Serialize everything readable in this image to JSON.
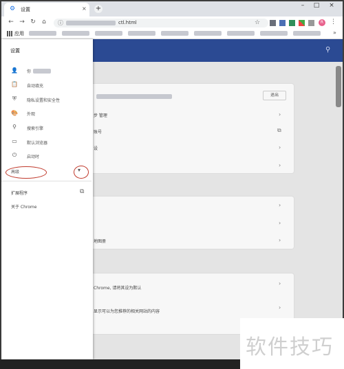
{
  "tab": {
    "title": "设置",
    "close": "×"
  },
  "newtab": "+",
  "window": {
    "minimize": "–",
    "maximize": "□",
    "close": "×"
  },
  "toolbar": {
    "url": "ctl.html",
    "avatar_text": "R"
  },
  "bookmarks": {
    "apps_label": "应用"
  },
  "drawer": {
    "title": "设置",
    "items": [
      {
        "icon": "person-icon",
        "label": "你"
      },
      {
        "icon": "clipboard-icon",
        "label": "自动填充"
      },
      {
        "icon": "shield-icon",
        "label": "隐私设置和安全性"
      },
      {
        "icon": "palette-icon",
        "label": "外观"
      },
      {
        "icon": "search-icon",
        "label": "搜索引擎"
      },
      {
        "icon": "browser-icon",
        "label": "默认浏览器"
      },
      {
        "icon": "power-icon",
        "label": "启动时"
      }
    ],
    "advanced": {
      "label": "高级",
      "arrow": "▾"
    },
    "extensions": {
      "label": "扩展程序",
      "icon": "open-external-icon"
    },
    "about": {
      "label": "关于 Chrome"
    }
  },
  "cards": {
    "card1": {
      "button": "退出",
      "rows": [
        "步 管理",
        "账号",
        "设",
        ""
      ]
    },
    "card2": {
      "rows": [
        "",
        "",
        "地图册"
      ]
    },
    "card3": {
      "rows": [
        "Chrome, 请将其设为默认",
        "显示可以为您推荐的相关网站的内容"
      ]
    }
  },
  "watermark": "软件技巧",
  "colors": {
    "header": "#2b4a93",
    "annotation": "#c0392b",
    "accent": "#1a73e8"
  }
}
